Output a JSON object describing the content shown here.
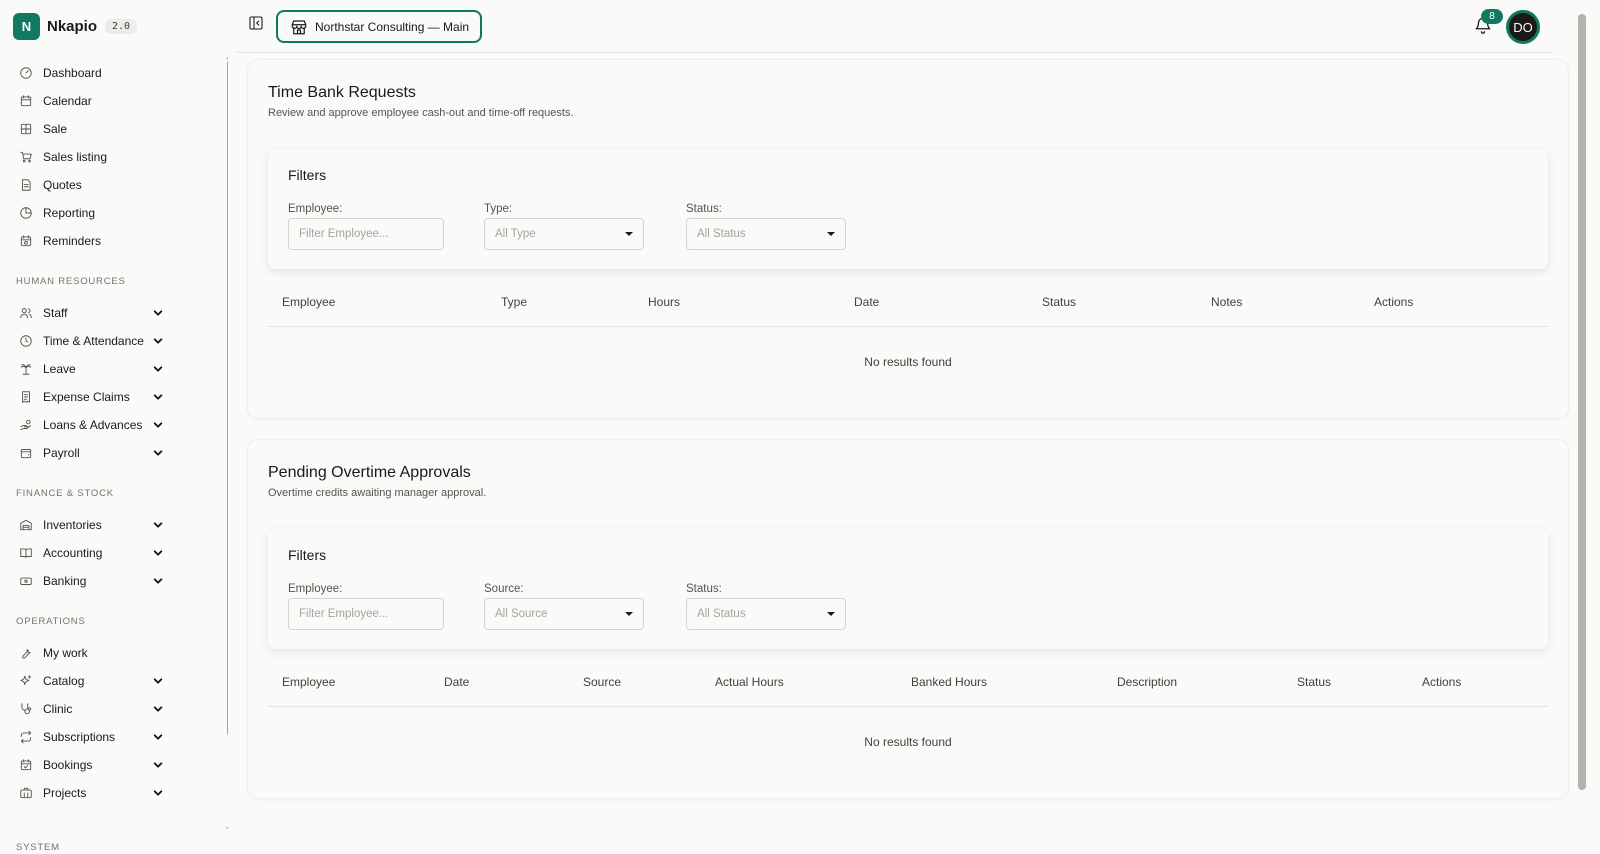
{
  "brand": {
    "logo_letter": "N",
    "name": "Nkapio",
    "version": "2.0"
  },
  "sidebar": {
    "top_items": [
      {
        "label": "Dashboard",
        "icon": "gauge-icon"
      },
      {
        "label": "Calendar",
        "icon": "calendar-icon"
      },
      {
        "label": "Sale",
        "icon": "grid-icon"
      },
      {
        "label": "Sales listing",
        "icon": "cart-icon"
      },
      {
        "label": "Quotes",
        "icon": "document-icon"
      },
      {
        "label": "Reporting",
        "icon": "pie-chart-icon"
      },
      {
        "label": "Reminders",
        "icon": "calendar-clock-icon"
      }
    ],
    "hr_title": "HUMAN RESOURCES",
    "hr_items": [
      {
        "label": "Staff",
        "icon": "users-icon"
      },
      {
        "label": "Time & Attendance",
        "icon": "clock-icon"
      },
      {
        "label": "Leave",
        "icon": "palm-tree-icon"
      },
      {
        "label": "Expense Claims",
        "icon": "receipt-icon"
      },
      {
        "label": "Loans & Advances",
        "icon": "hand-coins-icon"
      },
      {
        "label": "Payroll",
        "icon": "wallet-icon"
      }
    ],
    "finance_title": "FINANCE & STOCK",
    "finance_items": [
      {
        "label": "Inventories",
        "icon": "warehouse-icon"
      },
      {
        "label": "Accounting",
        "icon": "book-icon"
      },
      {
        "label": "Banking",
        "icon": "banknote-icon"
      }
    ],
    "ops_title": "OPERATIONS",
    "ops_items": [
      {
        "label": "My work",
        "icon": "wrench-icon"
      },
      {
        "label": "Catalog",
        "icon": "sparkles-icon"
      },
      {
        "label": "Clinic",
        "icon": "stethoscope-icon"
      },
      {
        "label": "Subscriptions",
        "icon": "repeat-icon"
      },
      {
        "label": "Bookings",
        "icon": "calendar-check-icon"
      },
      {
        "label": "Projects",
        "icon": "briefcase-icon"
      }
    ],
    "system_title": "SYSTEM"
  },
  "topbar": {
    "branch_label": "Northstar Consulting — Main",
    "notification_count": "8",
    "avatar_initials": "DO"
  },
  "time_bank": {
    "title": "Time Bank Requests",
    "subtitle": "Review and approve employee cash-out and time-off requests.",
    "filters_title": "Filters",
    "employee_label": "Employee:",
    "employee_placeholder": "Filter Employee...",
    "type_label": "Type:",
    "type_value": "All Type",
    "status_label": "Status:",
    "status_value": "All Status",
    "columns": [
      "Employee",
      "Type",
      "Hours",
      "Date",
      "Status",
      "Notes",
      "Actions"
    ],
    "empty_text": "No results found"
  },
  "overtime": {
    "title": "Pending Overtime Approvals",
    "subtitle": "Overtime credits awaiting manager approval.",
    "filters_title": "Filters",
    "employee_label": "Employee:",
    "employee_placeholder": "Filter Employee...",
    "source_label": "Source:",
    "source_value": "All Source",
    "status_label": "Status:",
    "status_value": "All Status",
    "columns": [
      "Employee",
      "Date",
      "Source",
      "Actual Hours",
      "Banked Hours",
      "Description",
      "Status",
      "Actions"
    ],
    "empty_text": "No results found"
  }
}
